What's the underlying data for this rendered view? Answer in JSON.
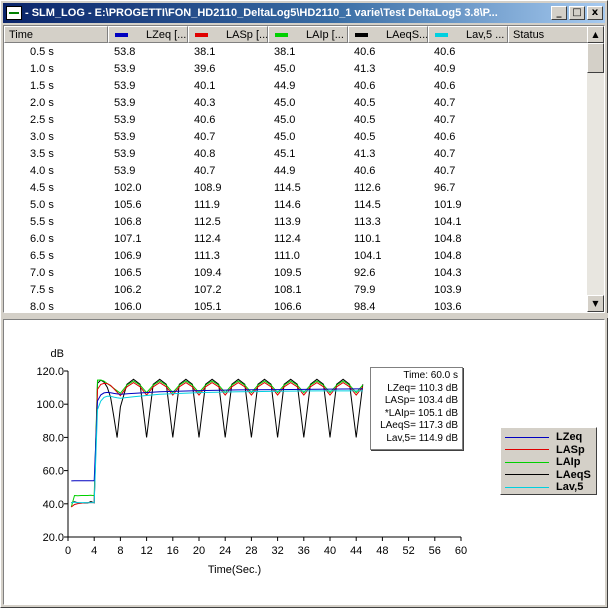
{
  "window": {
    "title": "- SLM_LOG -   E:\\PROGETTI\\FON_HD2110_DeltaLog5\\HD2110_1 varie\\Test DeltaLog5 3.8\\P...",
    "minimize_glyph": "_",
    "maximize_glyph": "□",
    "close_glyph": "x"
  },
  "table": {
    "columns": [
      {
        "label": "Time",
        "color": null
      },
      {
        "label": "LZeq [...",
        "color": "#0000c0"
      },
      {
        "label": "LASp [...",
        "color": "#e00000"
      },
      {
        "label": "LAIp [...",
        "color": "#00d000"
      },
      {
        "label": "LAeqS...",
        "color": "#000000"
      },
      {
        "label": "Lav,5 ...",
        "color": "#00d0e0"
      },
      {
        "label": "Status",
        "color": null
      }
    ],
    "rows": [
      [
        "0.5 s",
        "53.8",
        "38.1",
        "38.1",
        "40.6",
        "40.6",
        ""
      ],
      [
        "1.0 s",
        "53.9",
        "39.6",
        "45.0",
        "41.3",
        "40.9",
        ""
      ],
      [
        "1.5 s",
        "53.9",
        "40.1",
        "44.9",
        "40.6",
        "40.6",
        ""
      ],
      [
        "2.0 s",
        "53.9",
        "40.3",
        "45.0",
        "40.5",
        "40.7",
        ""
      ],
      [
        "2.5 s",
        "53.9",
        "40.6",
        "45.0",
        "40.5",
        "40.7",
        ""
      ],
      [
        "3.0 s",
        "53.9",
        "40.7",
        "45.0",
        "40.5",
        "40.6",
        ""
      ],
      [
        "3.5 s",
        "53.9",
        "40.8",
        "45.1",
        "41.3",
        "40.7",
        ""
      ],
      [
        "4.0 s",
        "53.9",
        "40.7",
        "44.9",
        "40.6",
        "40.7",
        ""
      ],
      [
        "4.5 s",
        "102.0",
        "108.9",
        "114.5",
        "112.6",
        "96.7",
        ""
      ],
      [
        "5.0 s",
        "105.6",
        "111.9",
        "114.6",
        "114.5",
        "101.9",
        ""
      ],
      [
        "5.5 s",
        "106.8",
        "112.5",
        "113.9",
        "113.3",
        "104.1",
        ""
      ],
      [
        "6.0 s",
        "107.1",
        "112.4",
        "112.4",
        "110.1",
        "104.8",
        ""
      ],
      [
        "6.5 s",
        "106.9",
        "111.3",
        "111.0",
        "104.1",
        "104.8",
        ""
      ],
      [
        "7.0 s",
        "106.5",
        "109.4",
        "109.5",
        "92.6",
        "104.3",
        ""
      ],
      [
        "7.5 s",
        "106.2",
        "107.2",
        "108.1",
        "79.9",
        "103.9",
        ""
      ],
      [
        "8.0 s",
        "106.0",
        "105.1",
        "106.6",
        "98.4",
        "103.6",
        ""
      ]
    ],
    "scroll_up_glyph": "▲",
    "scroll_down_glyph": "▼"
  },
  "graph": {
    "y_unit": "dB",
    "x_label": "Time(Sec.)",
    "info": [
      "Time: 60.0 s",
      "LZeq= 110.3 dB",
      "LASp= 103.4 dB",
      "*LAIp= 105.1 dB",
      "LAeqS= 117.3 dB",
      "Lav,5= 114.9 dB"
    ],
    "legend": [
      {
        "label": "LZeq",
        "color": "#0000c0"
      },
      {
        "label": "LASp",
        "color": "#e00000"
      },
      {
        "label": "LAIp",
        "color": "#00d000"
      },
      {
        "label": "LAeqS",
        "color": "#000000"
      },
      {
        "label": "Lav,5",
        "color": "#00d0e0"
      }
    ]
  },
  "chart_data": {
    "type": "line",
    "xlabel": "Time(Sec.)",
    "ylabel": "dB",
    "xlim": [
      0,
      60
    ],
    "ylim": [
      20,
      120
    ],
    "x_ticks": [
      0,
      4,
      8,
      12,
      16,
      20,
      24,
      28,
      32,
      36,
      40,
      44,
      48,
      52,
      56,
      60
    ],
    "y_ticks": [
      20,
      40,
      60,
      80,
      100,
      120
    ],
    "y_tick_labels": [
      "20.0",
      "40.0",
      "60.0",
      "80.0",
      "100.0",
      "120.0"
    ],
    "grid": false,
    "legend_position": "right",
    "series": [
      {
        "name": "LZeq",
        "color": "#0000c0",
        "x": [
          0.5,
          1,
          1.5,
          2,
          2.5,
          3,
          3.5,
          4,
          4.5,
          5,
          5.5,
          6,
          6.5,
          7,
          7.5,
          8,
          10,
          14,
          20,
          26,
          32,
          38,
          44,
          45
        ],
        "y": [
          53.8,
          53.9,
          53.9,
          53.9,
          53.9,
          53.9,
          53.9,
          53.9,
          102.0,
          105.6,
          106.8,
          107.1,
          106.9,
          106.5,
          106.2,
          106.0,
          106.5,
          107.5,
          108.2,
          108.6,
          108.8,
          109.0,
          109.2,
          109.2
        ]
      },
      {
        "name": "LASp",
        "color": "#e00000",
        "x": [
          0.5,
          1,
          1.5,
          2,
          2.5,
          3,
          3.5,
          4,
          4.5,
          5,
          5.5,
          6,
          6.5,
          7,
          7.5,
          8,
          9,
          10,
          11,
          12,
          13,
          14,
          15,
          16,
          17,
          18,
          19,
          20,
          21,
          22,
          23,
          24,
          25,
          26,
          27,
          28,
          29,
          30,
          31,
          32,
          33,
          34,
          35,
          36,
          37,
          38,
          39,
          40,
          41,
          42,
          43,
          44,
          45
        ],
        "y": [
          38.1,
          39.6,
          40.1,
          40.3,
          40.6,
          40.7,
          40.8,
          40.7,
          108.9,
          111.9,
          112.5,
          112.4,
          111.3,
          109.4,
          107.2,
          105.1,
          110.5,
          113.0,
          110.5,
          105.5,
          110.5,
          113.0,
          110.5,
          105.5,
          110.5,
          113.0,
          110.5,
          105.5,
          110.5,
          113.0,
          110.5,
          105.5,
          110.5,
          113.0,
          110.5,
          105.5,
          110.5,
          113.0,
          110.5,
          105.5,
          110.5,
          113.0,
          110.5,
          105.5,
          110.5,
          113.0,
          110.5,
          105.5,
          110.5,
          113.0,
          110.5,
          105.5,
          110.5
        ]
      },
      {
        "name": "LAIp",
        "color": "#00d000",
        "x": [
          0.5,
          1,
          1.5,
          2,
          2.5,
          3,
          3.5,
          4,
          4.5,
          5,
          5.5,
          6,
          6.5,
          7,
          7.5,
          8,
          9,
          10,
          11,
          12,
          13,
          14,
          15,
          16,
          17,
          18,
          19,
          20,
          21,
          22,
          23,
          24,
          25,
          26,
          27,
          28,
          29,
          30,
          31,
          32,
          33,
          34,
          35,
          36,
          37,
          38,
          39,
          40,
          41,
          42,
          43,
          44,
          45
        ],
        "y": [
          38.1,
          45.0,
          44.9,
          45.0,
          45.0,
          45.0,
          45.1,
          44.9,
          114.5,
          114.6,
          113.9,
          112.4,
          111.0,
          109.5,
          108.1,
          106.6,
          111.5,
          114.0,
          111.5,
          107.0,
          111.5,
          114.0,
          111.5,
          107.0,
          111.5,
          114.0,
          111.5,
          107.0,
          111.5,
          114.0,
          111.5,
          107.0,
          111.5,
          114.0,
          111.5,
          107.0,
          111.5,
          114.0,
          111.5,
          107.0,
          111.5,
          114.0,
          111.5,
          107.0,
          111.5,
          114.0,
          111.5,
          107.0,
          111.5,
          114.0,
          111.5,
          107.0,
          111.5
        ]
      },
      {
        "name": "LAeqS",
        "color": "#000000",
        "x": [
          0.5,
          1,
          1.5,
          2,
          2.5,
          3,
          3.5,
          4,
          4.5,
          5,
          5.5,
          6,
          6.5,
          7,
          7.5,
          8,
          9,
          10,
          11,
          12,
          13,
          14,
          15,
          16,
          17,
          18,
          19,
          20,
          21,
          22,
          23,
          24,
          25,
          26,
          27,
          28,
          29,
          30,
          31,
          32,
          33,
          34,
          35,
          36,
          37,
          38,
          39,
          40,
          41,
          42,
          43,
          44,
          45
        ],
        "y": [
          40.6,
          41.3,
          40.6,
          40.5,
          40.5,
          40.5,
          41.3,
          40.6,
          112.6,
          114.5,
          113.3,
          110.1,
          104.1,
          92.6,
          79.9,
          98.4,
          112.0,
          115.0,
          112.0,
          80.0,
          112.0,
          115.0,
          112.0,
          80.0,
          112.0,
          115.0,
          112.0,
          80.0,
          112.0,
          115.0,
          112.0,
          80.0,
          112.0,
          115.0,
          112.0,
          80.0,
          112.0,
          115.0,
          112.0,
          80.0,
          112.0,
          115.0,
          112.0,
          80.0,
          112.0,
          115.0,
          112.0,
          80.0,
          112.0,
          115.0,
          112.0,
          80.0,
          112.0
        ]
      },
      {
        "name": "Lav,5",
        "color": "#00d0e0",
        "x": [
          0.5,
          1,
          1.5,
          2,
          2.5,
          3,
          3.5,
          4,
          4.5,
          5,
          5.5,
          6,
          6.5,
          7,
          7.5,
          8,
          10,
          14,
          20,
          26,
          32,
          38,
          44,
          45
        ],
        "y": [
          40.6,
          40.9,
          40.6,
          40.7,
          40.7,
          40.6,
          40.7,
          40.7,
          96.7,
          101.9,
          104.1,
          104.8,
          104.8,
          104.3,
          103.9,
          103.6,
          104.5,
          106.0,
          107.0,
          107.5,
          107.8,
          108.0,
          108.0,
          108.0
        ]
      }
    ]
  }
}
